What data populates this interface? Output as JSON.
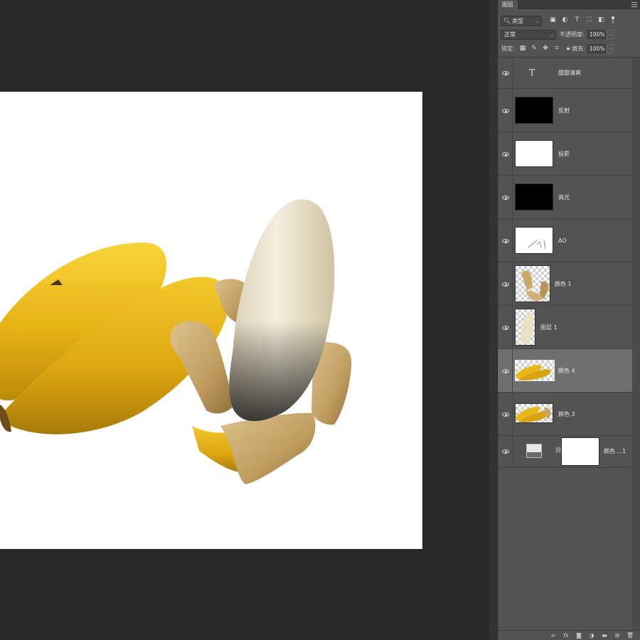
{
  "panel": {
    "tab_label": "图层",
    "filter": {
      "type_label": "类型"
    },
    "blend_mode": "正常",
    "opacity_label": "不透明度:",
    "opacity_value": "100%",
    "lock_label": "锁定:",
    "fill_label": "填充:",
    "fill_value": "100%"
  },
  "layers": [
    {
      "name": "甜甜清爽",
      "kind": "text"
    },
    {
      "name": "反射",
      "kind": "black"
    },
    {
      "name": "投影",
      "kind": "white"
    },
    {
      "name": "高光",
      "kind": "black"
    },
    {
      "name": "AO",
      "kind": "ao"
    },
    {
      "name": "颜色 1",
      "kind": "peel"
    },
    {
      "name": "图层 1",
      "kind": "fruit"
    },
    {
      "name": "颜色 4",
      "kind": "bananas",
      "selected": true
    },
    {
      "name": "颜色 3",
      "kind": "bananas"
    },
    {
      "name": "颜色 ...1",
      "kind": "adjustment"
    }
  ],
  "colors": {
    "workspace": "#282828",
    "panel": "#535353",
    "selected_layer": "#6f6f6f",
    "banana_yellow": "#e8b81a",
    "banana_flesh": "#efe8d2",
    "peel_brown": "#c6a56a"
  }
}
